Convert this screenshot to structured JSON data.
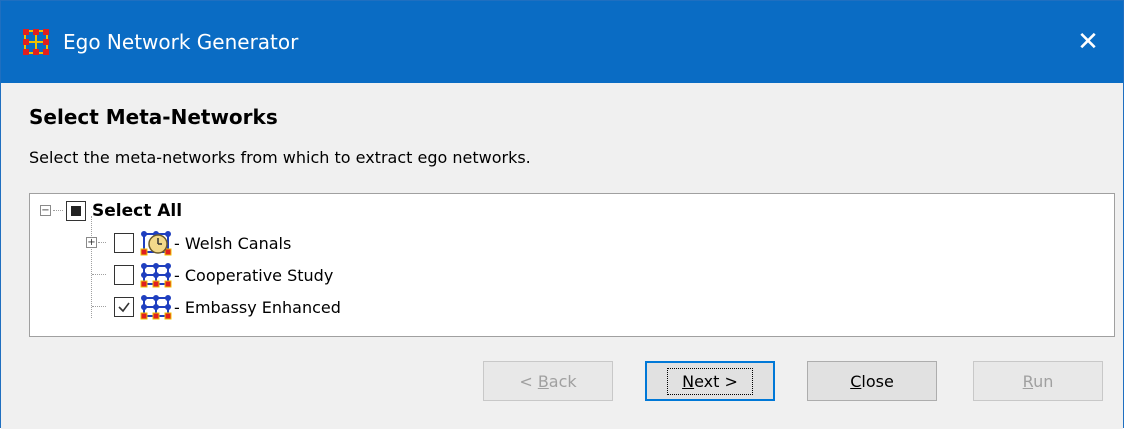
{
  "window": {
    "title": "Ego Network Generator",
    "close_glyph": "✕",
    "app_icon": "grid-network-icon"
  },
  "page": {
    "heading": "Select Meta-Networks",
    "description": "Select the meta-networks from which to extract ego networks."
  },
  "tree": {
    "root": {
      "label": "Select All",
      "state": "partial"
    },
    "items": [
      {
        "label": "- Welsh Canals",
        "checked": false,
        "expandable": true,
        "icon": "meta-network-clock-icon"
      },
      {
        "label": "- Cooperative Study",
        "checked": false,
        "expandable": false,
        "icon": "meta-network-icon"
      },
      {
        "label": "- Embassy Enhanced",
        "checked": true,
        "expandable": false,
        "icon": "meta-network-icon"
      }
    ]
  },
  "buttons": {
    "back": {
      "pre": "< ",
      "u": "B",
      "post": "ack",
      "enabled": false
    },
    "next": {
      "pre": "",
      "u": "N",
      "post": "ext >",
      "enabled": true
    },
    "close": {
      "pre": "",
      "u": "C",
      "post": "lose",
      "enabled": true
    },
    "run": {
      "pre": "",
      "u": "R",
      "post": "un",
      "enabled": false
    }
  },
  "colors": {
    "titlebar": "#0a6cc4",
    "node_blue": "#1f3fbf",
    "node_red": "#e02020",
    "node_yellow": "#f0c000"
  }
}
